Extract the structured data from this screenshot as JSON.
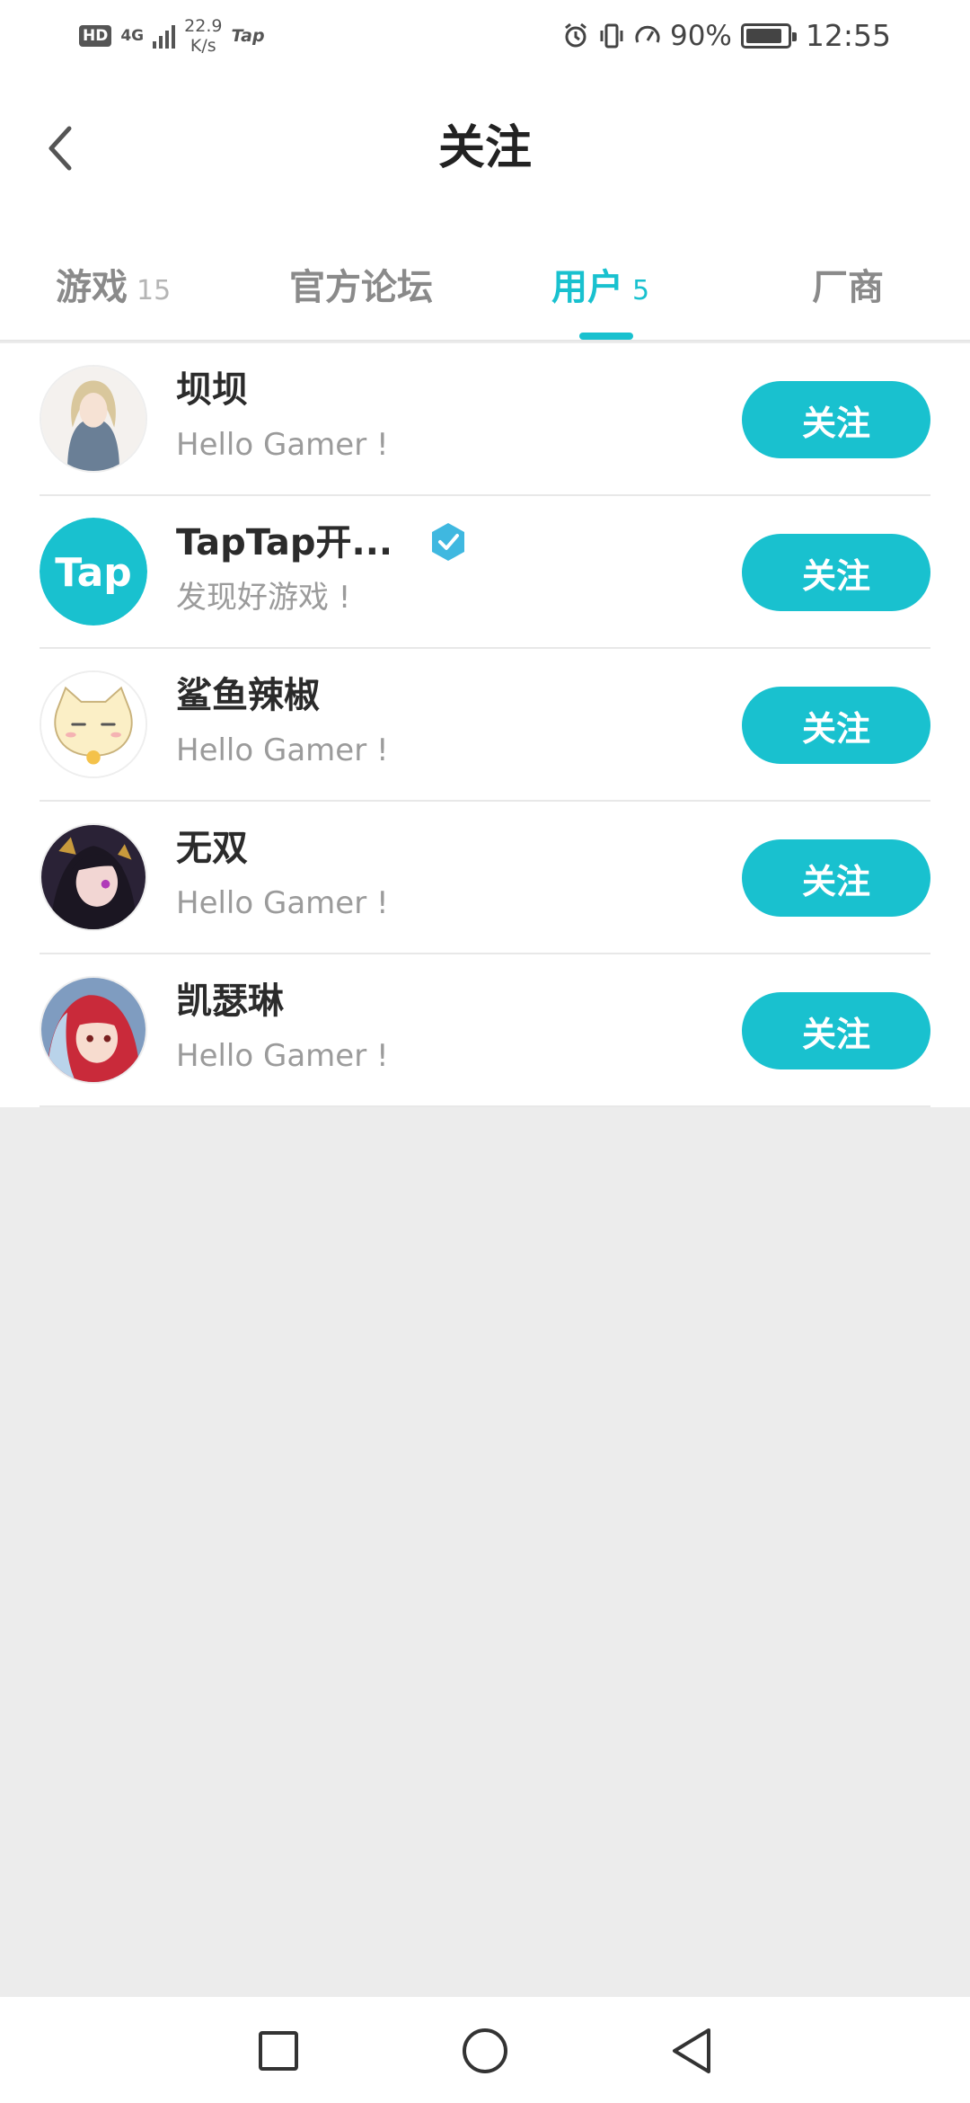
{
  "status_bar": {
    "hd": "HD",
    "network": "4G",
    "speed_value": "22.9",
    "speed_unit": "K/s",
    "app_badge": "Tap",
    "battery_percent": "90%",
    "battery_level": 0.9,
    "time": "12:55"
  },
  "header": {
    "title": "关注"
  },
  "tabs": [
    {
      "label": "游戏",
      "count": "15"
    },
    {
      "label": "官方论坛",
      "count": ""
    },
    {
      "label": "用户",
      "count": "5"
    },
    {
      "label": "厂商",
      "count": ""
    }
  ],
  "active_tab": "用户",
  "accent_color": "#19c1cf",
  "users": [
    {
      "name": "坝坝",
      "bio": "Hello Gamer !",
      "button": "关注",
      "verified": false
    },
    {
      "name": "TapTap开...",
      "bio": "发现好游戏 !",
      "button": "关注",
      "verified": true,
      "avatar_text": "Tap"
    },
    {
      "name": "鲨鱼辣椒",
      "bio": "Hello Gamer !",
      "button": "关注",
      "verified": false
    },
    {
      "name": "无双",
      "bio": "Hello Gamer !",
      "button": "关注",
      "verified": false
    },
    {
      "name": "凯瑟琳",
      "bio": "Hello Gamer !",
      "button": "关注",
      "verified": false
    }
  ],
  "icons": {
    "back": "chevron-left-icon",
    "verified": "verified-badge-icon",
    "nav_recent": "square-icon",
    "nav_home": "circle-icon",
    "nav_back": "triangle-back-icon"
  }
}
